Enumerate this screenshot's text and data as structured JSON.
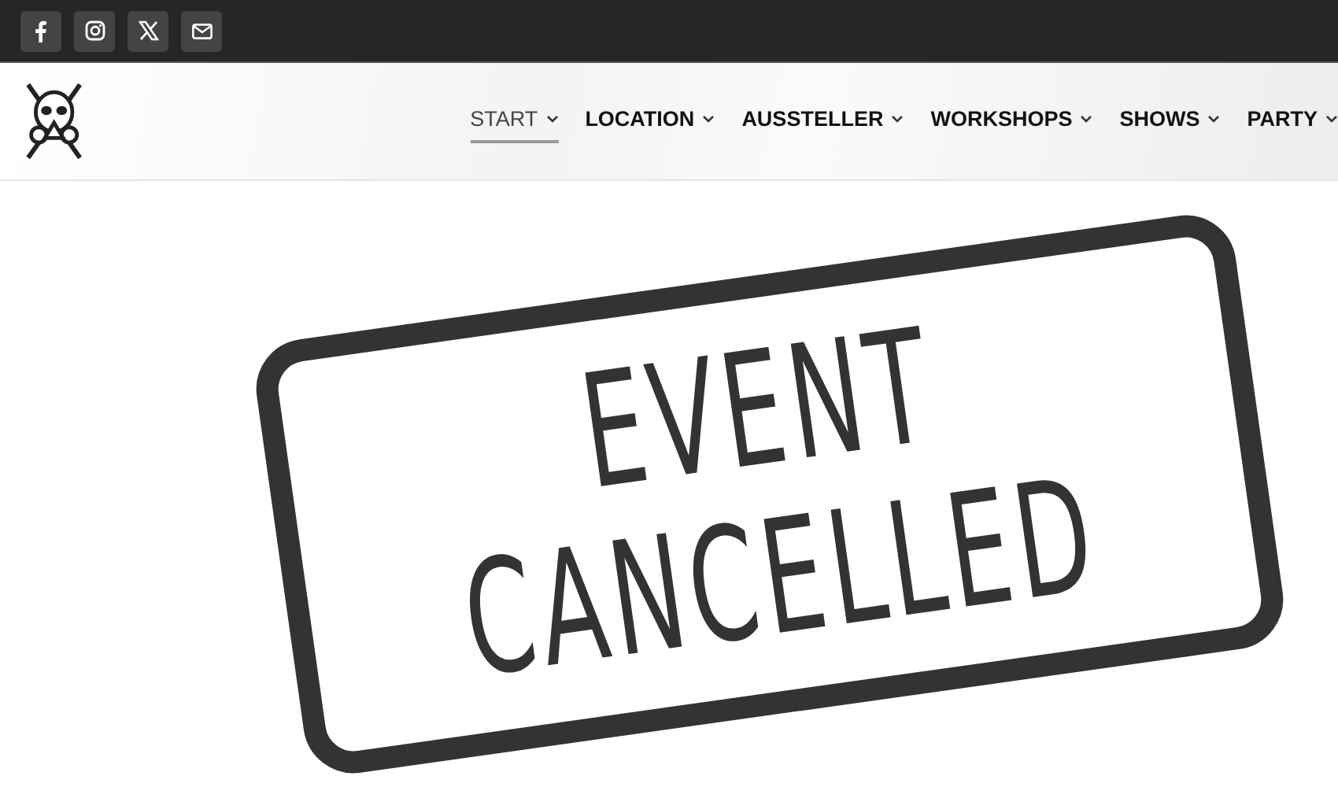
{
  "social_links": [
    {
      "kind": "facebook"
    },
    {
      "kind": "instagram"
    },
    {
      "kind": "x"
    },
    {
      "kind": "email"
    }
  ],
  "nav": [
    {
      "label": "START",
      "selected": true
    },
    {
      "label": "LOCATION",
      "selected": false
    },
    {
      "label": "AUSSTELLER",
      "selected": false
    },
    {
      "label": "WORKSHOPS",
      "selected": false
    },
    {
      "label": "SHOWS",
      "selected": false
    },
    {
      "label": "PARTY",
      "selected": false
    }
  ],
  "stamp": {
    "lines": [
      "EVENT",
      "CANCELLED"
    ]
  }
}
